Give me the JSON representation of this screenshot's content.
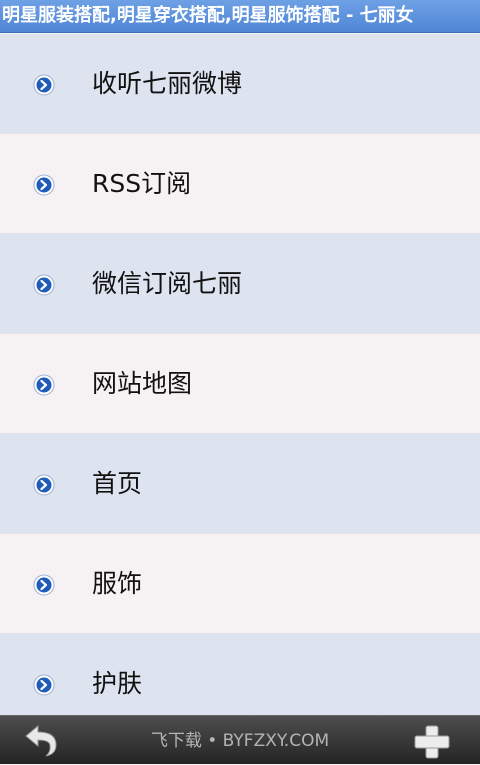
{
  "header": {
    "title": "明星服装搭配,明星穿衣搭配,明星服饰搭配 - 七丽女"
  },
  "menu": {
    "items": [
      {
        "label": "收听七丽微博",
        "icon": "chevron-right-circle-icon"
      },
      {
        "label": "RSS订阅",
        "icon": "chevron-right-circle-icon"
      },
      {
        "label": "微信订阅七丽",
        "icon": "chevron-right-circle-icon"
      },
      {
        "label": "网站地图",
        "icon": "chevron-right-circle-icon"
      },
      {
        "label": "首页",
        "icon": "chevron-right-circle-icon"
      },
      {
        "label": "服饰",
        "icon": "chevron-right-circle-icon"
      },
      {
        "label": "护肤",
        "icon": "chevron-right-circle-icon"
      }
    ]
  },
  "bottom_bar": {
    "back_icon": "back-arrow-icon",
    "watermark": "飞下载 • BYFZXY.COM",
    "add_icon": "plus-icon"
  },
  "colors": {
    "title_bar": "#5b8fdc",
    "row_odd": "#dde3ef",
    "row_even": "#f6f2f4",
    "bullet": "#1f5bb8",
    "bottom_bar": "#333333"
  }
}
